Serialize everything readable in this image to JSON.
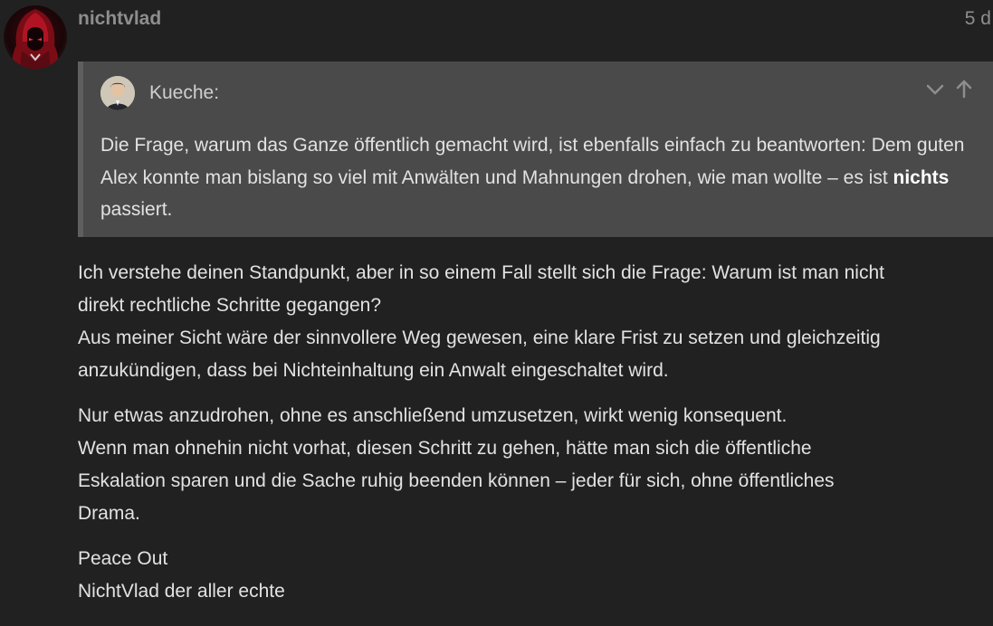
{
  "post": {
    "author": "nichtvlad",
    "date": "5 d",
    "avatar_icon": "hooded-assassin-avatar"
  },
  "quote": {
    "author": "Kueche:",
    "avatar_icon": "user-avatar",
    "controls": [
      "chevron-down-icon",
      "arrow-up-icon"
    ],
    "text_before": "Die Frage, warum das Ganze öffentlich gemacht wird, ist ebenfalls einfach zu beantworten: Dem guten Alex konnte man bislang so viel mit Anwälten und Mahnungen drohen, wie man wollte – es ist ",
    "text_bold": "nichts",
    "text_after": " passiert."
  },
  "body": {
    "p1_l1": "Ich verstehe deinen Standpunkt, aber in so einem Fall stellt sich die Frage: Warum ist man nicht",
    "p1_l2": "direkt rechtliche Schritte gegangen?",
    "p1_l3": "Aus meiner Sicht wäre der sinnvollere Weg gewesen, eine klare Frist zu setzen und gleichzeitig",
    "p1_l4": "anzukündigen, dass bei Nichteinhaltung ein Anwalt eingeschaltet wird.",
    "p2_l1": "Nur etwas anzudrohen, ohne es anschließend umzusetzen, wirkt wenig konsequent.",
    "p2_l2": "Wenn man ohnehin nicht vorhat, diesen Schritt zu gehen, hätte man sich die öffentliche",
    "p2_l3": "Eskalation sparen und die Sache ruhig beenden können – jeder für sich, ohne öffentliches",
    "p2_l4": "Drama.",
    "p3_l1": "Peace Out",
    "p3_l2": "NichtVlad der aller echte"
  },
  "colors": {
    "background": "#212121",
    "quote_background": "#4a4a4a",
    "quote_border": "#5f5f5f",
    "muted_text": "#8e8e8e",
    "avatar_red": "#c0182a"
  }
}
